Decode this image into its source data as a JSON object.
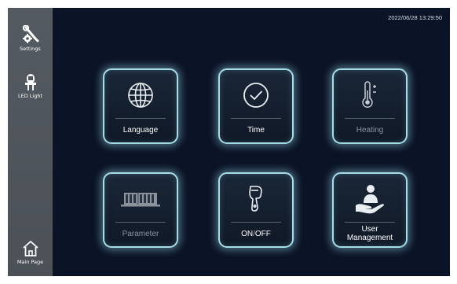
{
  "sidebar": {
    "settings_label": "Settings",
    "led_label": "LED Light",
    "main_label": "Main Page"
  },
  "header": {
    "datetime": "2022/06/28 13:29:50"
  },
  "tiles": {
    "language": "Language",
    "time": "Time",
    "heating": "Heating",
    "parameter": "Parameter",
    "on": "ON",
    "slash": " / ",
    "off": "OFF",
    "user_line1": "User",
    "user_line2": "Management"
  }
}
